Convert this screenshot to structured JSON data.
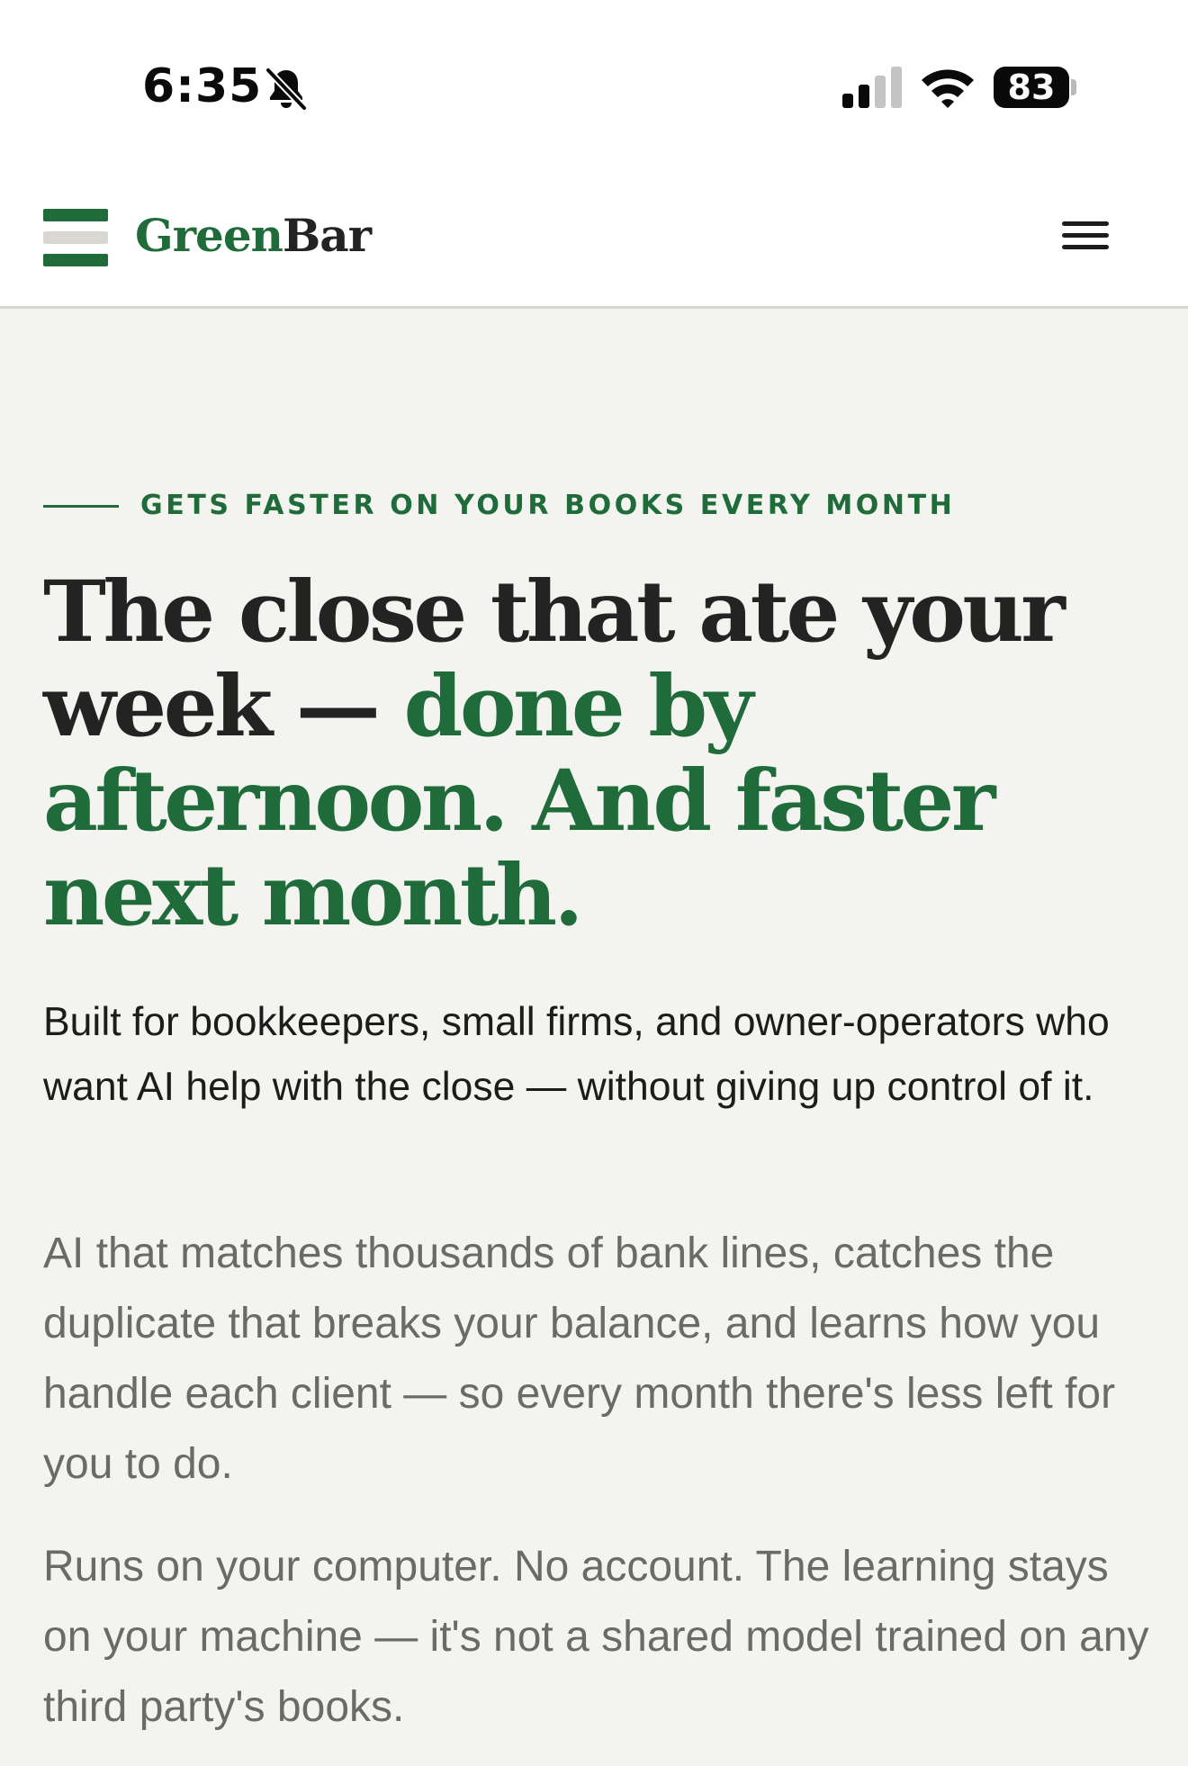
{
  "status_bar": {
    "time": "6:35",
    "battery_percent": "83",
    "icons": [
      "bell-slash-icon",
      "cellular-signal-icon",
      "wifi-icon",
      "battery-icon"
    ],
    "signal_bars_active": 2,
    "signal_bars_total": 4
  },
  "header": {
    "brand_part1": "Green",
    "brand_part2": "Bar",
    "logo_icon": "three-bar-logo-icon",
    "menu_icon": "hamburger-menu-icon"
  },
  "hero": {
    "eyebrow": "GETS FASTER ON YOUR BOOKS EVERY MONTH",
    "headline_dark": "The close that ate your week — ",
    "headline_accent": "done by afternoon. And faster next month.",
    "lead": "Built for bookkeepers, small firms, and owner-operators who want AI help with the close — without giving up control of it.",
    "body1": "AI that matches thousands of bank lines, catches the duplicate that breaks your balance, and learns how you handle each client — so every month there's less left for you to do.",
    "body2": "Runs on your computer. No account. The learning stays on your machine — it's not a shared model trained on any third party's books."
  },
  "colors": {
    "brand_green": "#1f6b3a",
    "text_dark": "#232323",
    "text_muted": "#6a6a66",
    "page_background": "#f3f3f0",
    "header_background": "#ffffff"
  }
}
